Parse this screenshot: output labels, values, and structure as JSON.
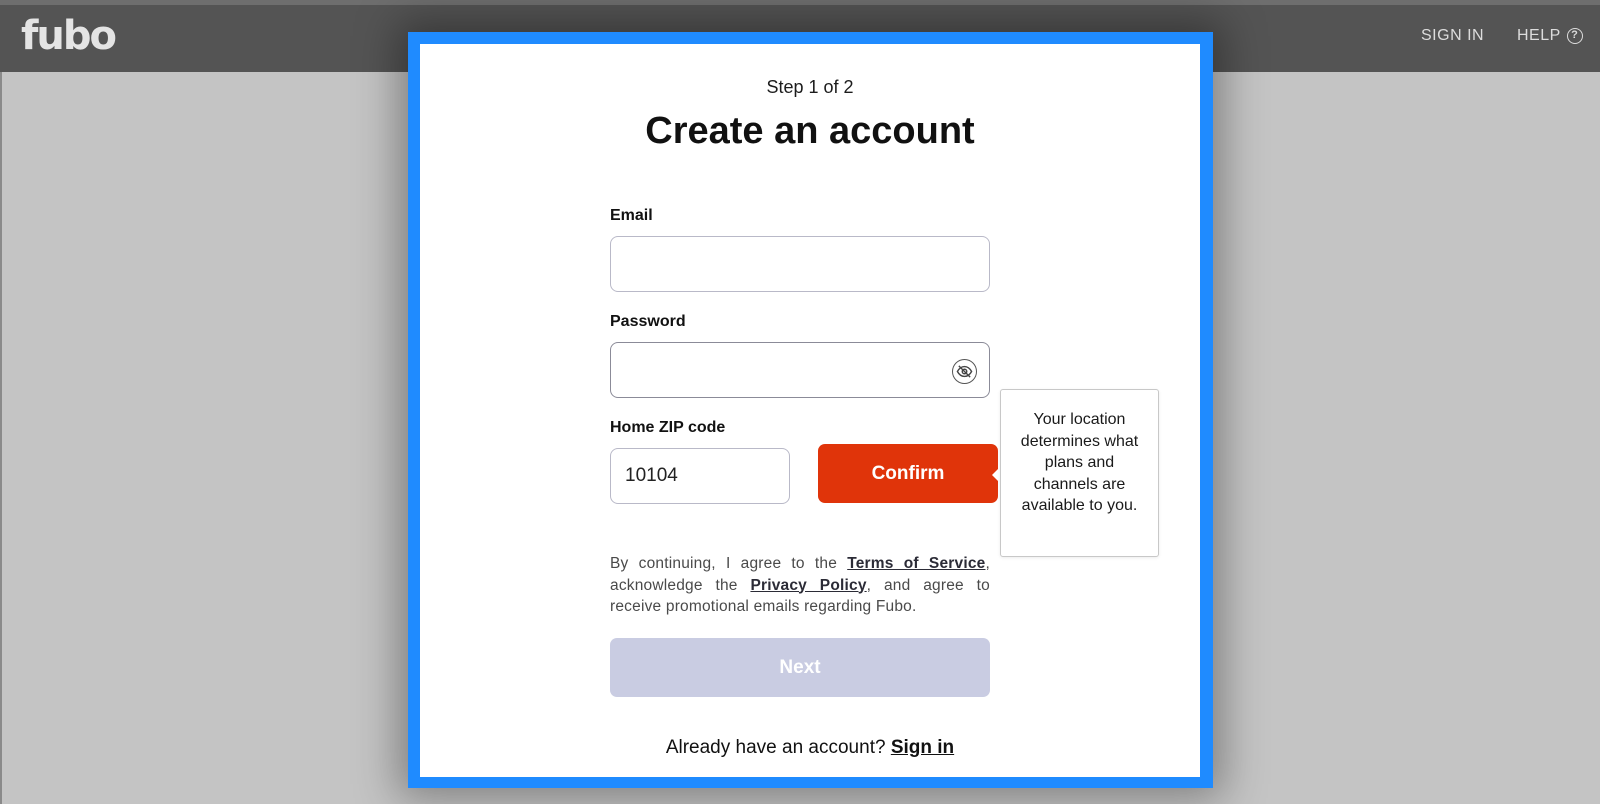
{
  "header": {
    "logo_text": "fubo",
    "sign_in_label": "SIGN IN",
    "help_label": "HELP",
    "help_icon": "?"
  },
  "form": {
    "step": "Step 1 of 2",
    "title": "Create an account",
    "email": {
      "label": "Email",
      "value": "",
      "placeholder": ""
    },
    "password": {
      "label": "Password",
      "value": "",
      "placeholder": "",
      "toggle_icon": "eye-off-icon"
    },
    "zip": {
      "label": "Home ZIP code",
      "value": "10104"
    },
    "confirm_label": "Confirm",
    "tooltip": "Your location determines what plans and channels are available to you.",
    "legal": {
      "part1": "By continuing, I agree to the ",
      "terms_link": "Terms of Service",
      "part2": ", acknowledge the ",
      "privacy_link": "Privacy Policy",
      "part3": ", and agree to receive promotional emails regarding Fubo."
    },
    "next_label": "Next",
    "already_text": "Already have an account? ",
    "sign_in_link": "Sign in"
  },
  "colors": {
    "accent": "#e0340a",
    "frame": "#1f8bff",
    "disabled_button": "#c9cce2"
  }
}
